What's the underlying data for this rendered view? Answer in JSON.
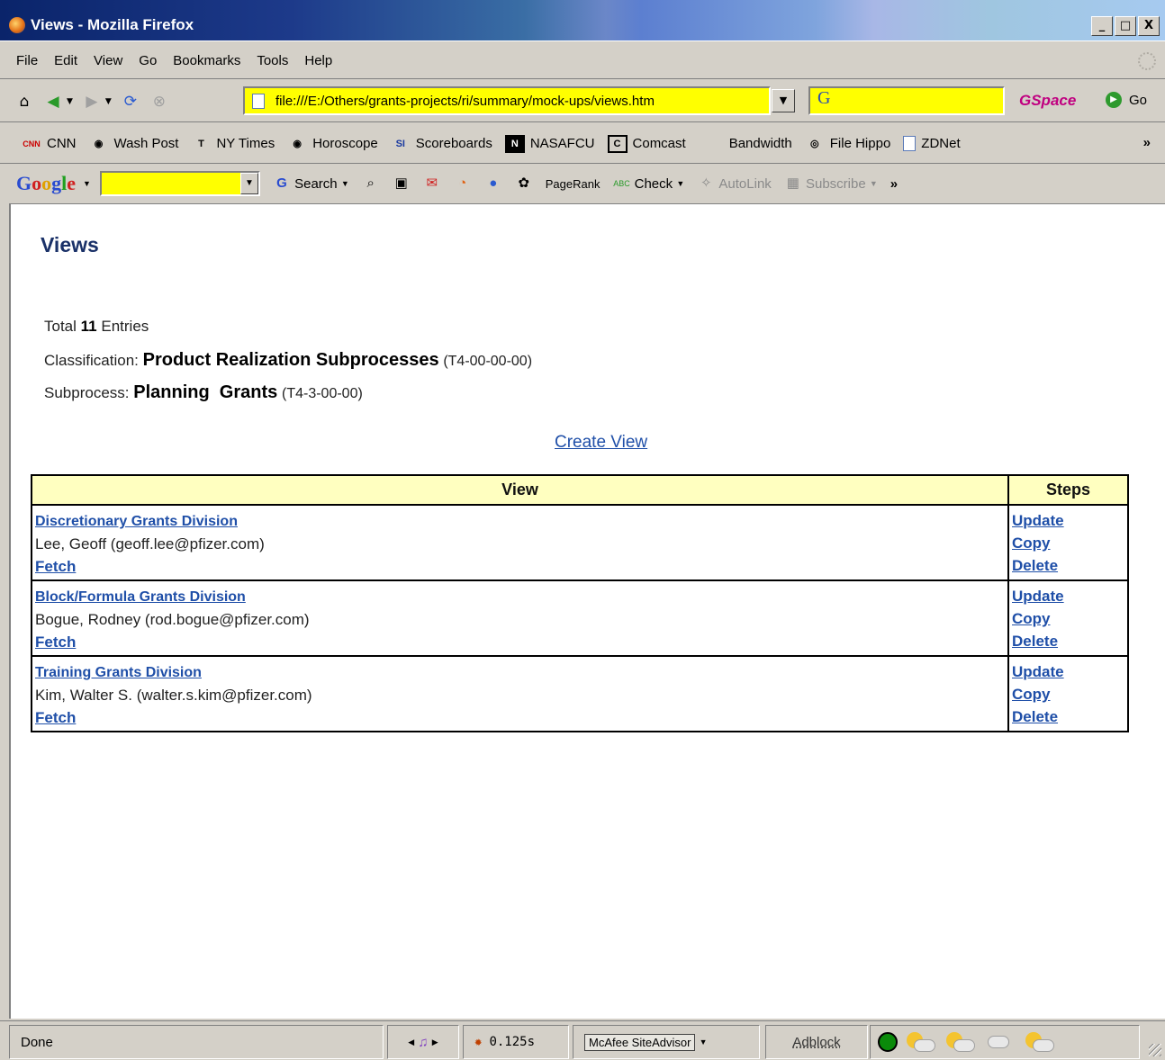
{
  "window": {
    "title": "Views - Mozilla Firefox",
    "buttons": [
      "_",
      "□",
      "X"
    ]
  },
  "menu": [
    "File",
    "Edit",
    "View",
    "Go",
    "Bookmarks",
    "Tools",
    "Help"
  ],
  "nav": {
    "url": "file:///E:/Others/grants-projects/ri/summary/mock-ups/views.htm",
    "search_logo": "G",
    "gspace": "GSpace",
    "go": "Go"
  },
  "bookmarks": [
    {
      "label": "CNN",
      "icon": "cnn-icon",
      "badge": "CNN"
    },
    {
      "label": "Wash Post",
      "icon": "wp-icon",
      "badge": "◉"
    },
    {
      "label": "NY Times",
      "icon": "nyt-icon",
      "badge": "𝕿"
    },
    {
      "label": "Horoscope",
      "icon": "horoscope-icon",
      "badge": "◉"
    },
    {
      "label": "Scoreboards",
      "icon": "si-icon",
      "badge": "SI"
    },
    {
      "label": "NASAFCU",
      "icon": "nasafcu-icon",
      "badge": "N"
    },
    {
      "label": "Comcast",
      "icon": "comcast-icon",
      "badge": "C"
    },
    {
      "label": "Bandwidth",
      "icon": "",
      "badge": ""
    },
    {
      "label": "File Hippo",
      "icon": "filehippo-icon",
      "badge": "60"
    },
    {
      "label": "ZDNet",
      "icon": "page-icon",
      "badge": ""
    }
  ],
  "bookmarks_more": "»",
  "google_toolbar": {
    "logo": [
      "G",
      "o",
      "o",
      "g",
      "l",
      "e"
    ],
    "search": "Search",
    "pagerank": "PageRank",
    "check": "Check",
    "autolink": "AutoLink",
    "subscribe": "Subscribe",
    "more": "»"
  },
  "page": {
    "title": "Views",
    "total_prefix": "Total",
    "total_count": "11",
    "total_suffix": "Entries",
    "classification_label": "Classification:",
    "classification_value": "Product Realization Subprocesses",
    "classification_code": "(T4-00-00-00)",
    "subprocess_label": "Subprocess:",
    "subprocess_value": "Planning  Grants",
    "subprocess_code": "(T4-3-00-00)",
    "create_link": "Create View",
    "table": {
      "headers": [
        "View",
        "Steps"
      ],
      "rows": [
        {
          "division": "Discretionary Grants Division",
          "owner": "Lee, Geoff (geoff.lee@pfizer.com)",
          "fetch": "Fetch",
          "update": "Update",
          "copy": "Copy",
          "delete": "Delete"
        },
        {
          "division": "Block/Formula Grants Division",
          "owner": "Bogue, Rodney (rod.bogue@pfizer.com)",
          "fetch": "Fetch",
          "update": "Update",
          "copy": "Copy",
          "delete": "Delete"
        },
        {
          "division": "Training Grants Division",
          "owner": "Kim, Walter S. (walter.s.kim@pfizer.com)",
          "fetch": "Fetch",
          "update": "Update",
          "copy": "Copy",
          "delete": "Delete"
        }
      ]
    }
  },
  "status": {
    "text": "Done",
    "timer": "0.125s",
    "mcafee": "McAfee SiteAdvisor",
    "adblock": "Adblock"
  },
  "colors": {
    "link": "#1f4fa8",
    "header_bg": "#ffffc0",
    "url_bg": "#ffff00"
  }
}
